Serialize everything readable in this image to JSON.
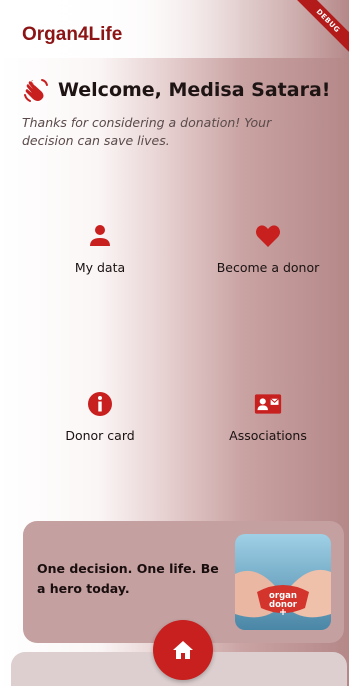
{
  "app_title": "Organ4Life",
  "debug_banner": "DEBUG",
  "welcome": {
    "greeting": "Welcome, Medisa Satara!",
    "subtitle": "Thanks for considering a donation! Your decision can save lives."
  },
  "tiles": [
    {
      "label": "My data",
      "icon": "person-icon"
    },
    {
      "label": "Become a donor",
      "icon": "heart-icon"
    },
    {
      "label": "Donor card",
      "icon": "info-icon"
    },
    {
      "label": "Associations",
      "icon": "contact-card-icon"
    }
  ],
  "banner": {
    "text": "One decision. One life. Be a hero today.",
    "image_text": "organ donor"
  },
  "nav": {
    "home_icon": "home-icon"
  },
  "colors": {
    "brand": "#8c1414",
    "accent": "#c81f1f",
    "banner_bg": "#c4a0a0"
  }
}
